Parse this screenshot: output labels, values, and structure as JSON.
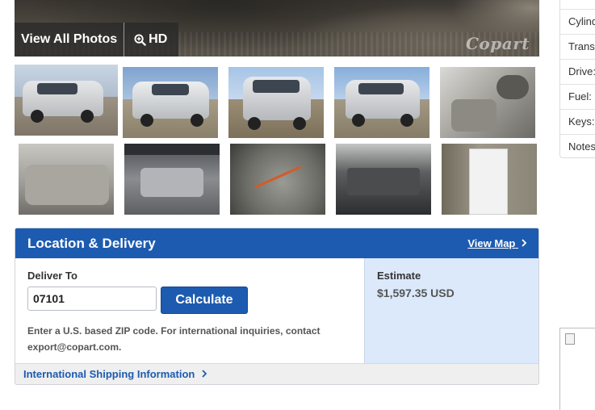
{
  "main_photo": {
    "view_all_label": "View All Photos",
    "hd_label": "HD",
    "watermark": "Copart"
  },
  "thumbnails": [
    {
      "subject": "front-three-quarter",
      "selected": true
    },
    {
      "subject": "front-three-quarter"
    },
    {
      "subject": "rear-three-quarter"
    },
    {
      "subject": "rear-three-quarter"
    },
    {
      "subject": "front-interior"
    },
    {
      "subject": "rear-seats"
    },
    {
      "subject": "engine-bay"
    },
    {
      "subject": "odometer"
    },
    {
      "subject": "radio"
    },
    {
      "subject": "vin-sticker"
    }
  ],
  "location_delivery": {
    "title": "Location & Delivery",
    "view_map": "View Map",
    "deliver_to_label": "Deliver To",
    "zip_value": "07101",
    "calculate_label": "Calculate",
    "hint": "Enter a U.S. based ZIP code. For international inquiries, contact export@copart.com.",
    "estimate_label": "Estimate",
    "estimate_value": "$1,597.35 USD",
    "intl_link": "International Shipping Information"
  },
  "side_panel": {
    "rows": [
      "Cylind",
      "Trans",
      "Drive:",
      "Fuel:",
      "Keys:",
      "Notes"
    ]
  },
  "colors": {
    "brand_blue": "#1d5bb0",
    "estimate_bg": "#dbe9fb"
  }
}
